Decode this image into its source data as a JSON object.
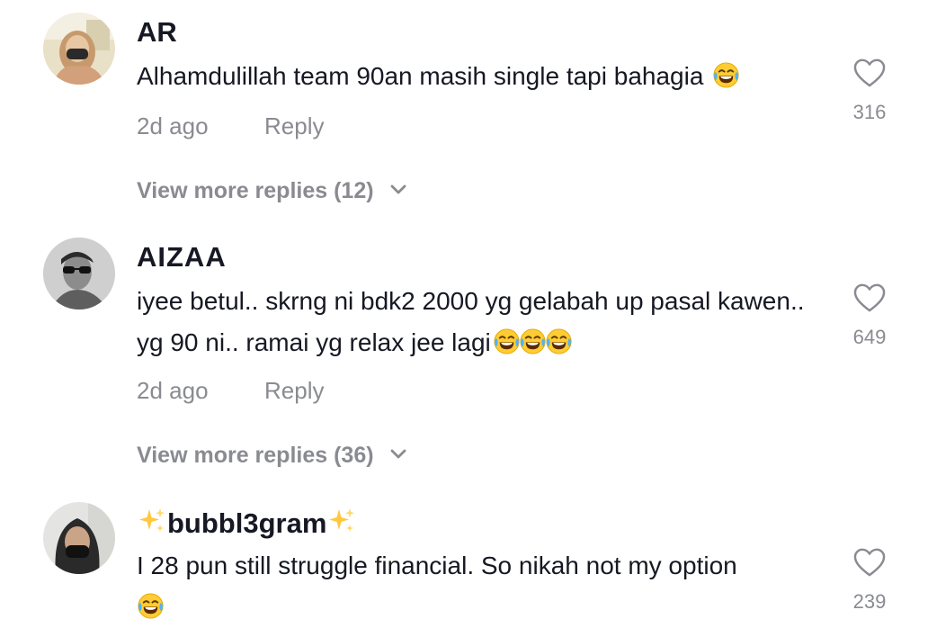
{
  "comments": [
    {
      "username": "AR",
      "text": "Alhamdulillah team 90an masih single tapi bahagia",
      "emoji_icons": [
        "tears-of-joy-emoji"
      ],
      "time": "2d ago",
      "reply_label": "Reply",
      "likes": "316",
      "view_more": "View more replies (12)"
    },
    {
      "username": "AIZAA",
      "text": "iyee betul.. skrng ni bdk2 2000 yg gelabah up pasal kawen.. yg 90 ni.. ramai yg relax jee lagi",
      "emoji_icons": [
        "tears-of-joy-emoji",
        "tears-of-joy-emoji",
        "tears-of-joy-emoji"
      ],
      "time": "2d ago",
      "reply_label": "Reply",
      "likes": "649",
      "view_more": "View more replies (36)"
    },
    {
      "username": "bubbl3gram",
      "username_decoration": "sparkles-emoji",
      "text": "I 28 pun still struggle financial. So nikah not my option",
      "emoji_icons": [
        "tears-of-joy-emoji"
      ],
      "likes": "239"
    }
  ],
  "icons": {
    "like": "heart-outline-icon",
    "expand": "chevron-down-icon"
  },
  "colors": {
    "primary_text": "#161823",
    "secondary_text": "#8a8b91"
  }
}
